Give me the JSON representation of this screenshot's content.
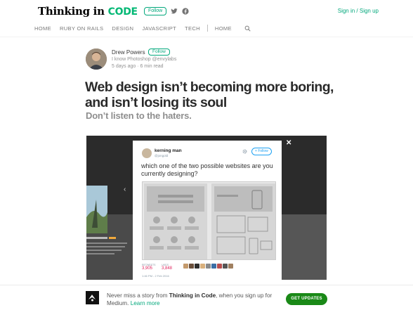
{
  "header": {
    "brand_primary": "Thinking in",
    "brand_accent": "CODE",
    "follow_label": "Follow",
    "signin_label": "Sign in / Sign up"
  },
  "nav": {
    "items": [
      "HOME",
      "RUBY ON RAILS",
      "DESIGN",
      "JAVASCRIPT",
      "TECH"
    ],
    "home_label": "HOME"
  },
  "author": {
    "name": "Drew Powers",
    "follow_label": "Follow",
    "bio": "I know Photoshop @envylabs",
    "meta": "5 days ago · 6 min read"
  },
  "article": {
    "title": "Web design isn’t becoming more boring, and isn’t losing its soul",
    "subtitle": "Don’t listen to the haters."
  },
  "hero": {
    "tweet": {
      "name": "kerning man",
      "handle": "@jongold",
      "follow_label": "Follow",
      "text": "which one of the two possible websites are you currently designing?",
      "retweets_label": "RETWEETS",
      "retweets": "3,905",
      "likes_label": "LIKES",
      "likes": "3,848",
      "date": "1:46 PM - 2 Feb 2016"
    }
  },
  "bottom_bar": {
    "text_prefix": "Never miss a story from",
    "publication": "Thinking in Code",
    "text_suffix": ", when you sign up for Medium.",
    "link": "Learn more",
    "button_label": "GET UPDATES"
  },
  "colors": {
    "accent": "#03a87c",
    "brand_green": "#02b875",
    "button_green": "#1a8917",
    "twitter_blue": "#1da1f2"
  }
}
